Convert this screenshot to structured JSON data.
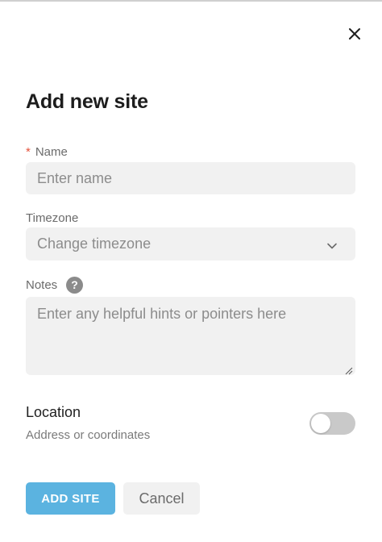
{
  "dialog": {
    "title": "Add new site",
    "close_icon": "close-icon"
  },
  "name_field": {
    "required_marker": "*",
    "label": "Name",
    "placeholder": "Enter name",
    "value": ""
  },
  "timezone_field": {
    "label": "Timezone",
    "selected": "Change timezone",
    "icon": "chevron-down-icon"
  },
  "notes_field": {
    "label": "Notes",
    "help_icon": "question-circle-icon",
    "help_glyph": "?",
    "placeholder": "Enter any helpful hints or pointers here",
    "value": ""
  },
  "location": {
    "title": "Location",
    "subtitle": "Address or coordinates",
    "toggle_on": false
  },
  "actions": {
    "primary_label": "ADD SITE",
    "secondary_label": "Cancel"
  },
  "colors": {
    "primary_button": "#5bb3e0",
    "required_marker": "#e5533d",
    "field_background": "#f1f1f1",
    "toggle_off": "#c9c9c9"
  }
}
